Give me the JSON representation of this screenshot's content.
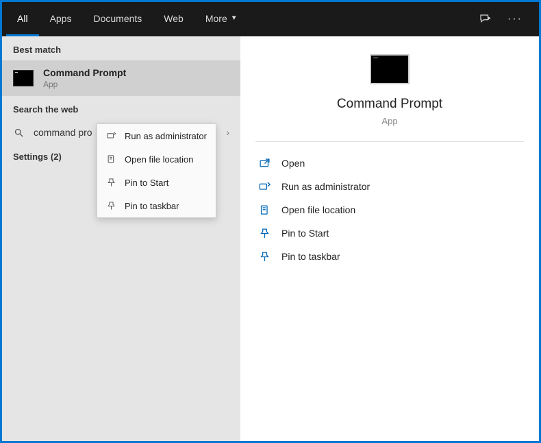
{
  "tabs": {
    "all": "All",
    "apps": "Apps",
    "documents": "Documents",
    "web": "Web",
    "more": "More"
  },
  "left": {
    "best_match_header": "Best match",
    "best_match": {
      "title": "Command Prompt",
      "subtitle": "App"
    },
    "search_web_header": "Search the web",
    "web_query": "command pro",
    "settings_header": "Settings (2)"
  },
  "context_menu": {
    "run_admin": "Run as administrator",
    "open_location": "Open file location",
    "pin_start": "Pin to Start",
    "pin_taskbar": "Pin to taskbar"
  },
  "preview": {
    "title": "Command Prompt",
    "subtitle": "App",
    "actions": {
      "open": "Open",
      "run_admin": "Run as administrator",
      "open_location": "Open file location",
      "pin_start": "Pin to Start",
      "pin_taskbar": "Pin to taskbar"
    }
  }
}
